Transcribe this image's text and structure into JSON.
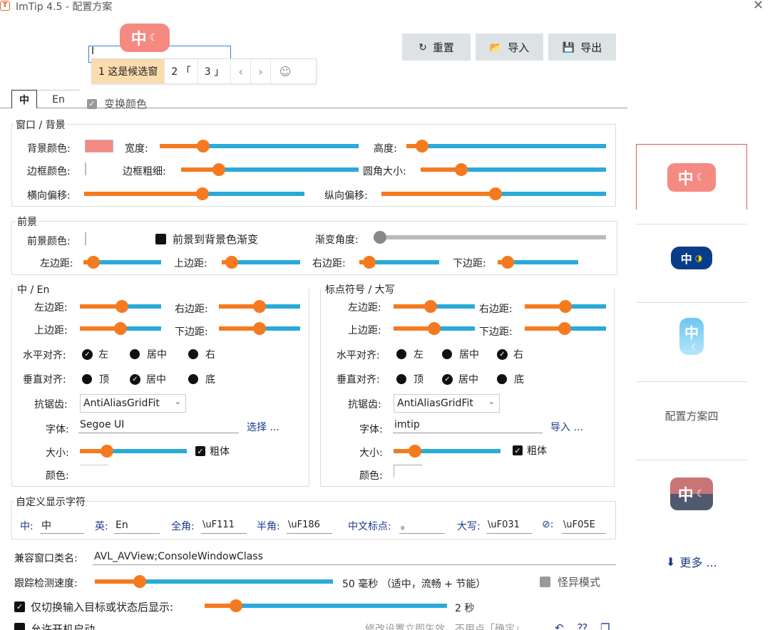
{
  "window": {
    "title": "ImTip 4.5 - 配置方案",
    "close": "✕",
    "icon": "T"
  },
  "preview": {
    "mark": "中",
    "moon": "☾",
    "caret": "I",
    "candidates": [
      {
        "label": "1 这是候选窗"
      },
      {
        "label": "2 「"
      },
      {
        "label": "3 」"
      }
    ],
    "nav_prev": "‹",
    "nav_next": "›",
    "emoji": "☺"
  },
  "toolbar": {
    "reset": {
      "icon": "↻",
      "label": "重置"
    },
    "import": {
      "icon": "📂",
      "label": "导入"
    },
    "export": {
      "icon": "💾",
      "label": "导出"
    }
  },
  "tabs": {
    "zh": "中",
    "en": "En",
    "swap_color": "变换颜色"
  },
  "window_group": {
    "title": "窗口 / 背景",
    "bg_color": "背景颜色:",
    "bg_color_hex": "#f58a83",
    "width": "宽度:",
    "height": "高度:",
    "border_color": "边框颜色:",
    "border_width": "边框粗细:",
    "corner_radius": "圆角大小:",
    "offset_x": "横向偏移:",
    "offset_y": "纵向偏移:",
    "width_value": 0.2,
    "height_value": 0.05,
    "border_width_value": 0.19,
    "corner_radius_value": 0.2,
    "offset_x_value": 0.54,
    "offset_y_value": 0.51
  },
  "fg_group": {
    "title": "前景",
    "fg_color": "前景颜色:",
    "gradient": "前景到背景色渐变",
    "gradient_angle": "渐变角度:",
    "gradient_angle_value": 0,
    "pad_left": "左边距:",
    "pad_top": "上边距:",
    "pad_right": "右边距:",
    "pad_bottom": "下边距:",
    "pad_left_value": 0.05,
    "pad_top_value": 0.05,
    "pad_right_value": 0.05,
    "pad_bottom_value": 0.05
  },
  "zh_group": {
    "title": "中 / En",
    "left": "左边距:",
    "right": "右边距:",
    "top": "上边距:",
    "bottom": "下边距:",
    "halign": "水平对齐:",
    "valign": "垂直对齐:",
    "h_left": "左",
    "h_center": "居中",
    "h_right": "右",
    "v_top": "顶",
    "v_center": "居中",
    "v_bottom": "底",
    "antialias": "抗锯齿:",
    "antialias_value": "AntiAliasGridFit",
    "font": "字体:",
    "font_value": "Segoe UI",
    "font_link": "选择 ...",
    "size": "大小:",
    "bold": "粗体",
    "color": "颜色:",
    "left_value": 0.52,
    "right_value": 0.5,
    "top_value": 0.5,
    "bottom_value": 0.5,
    "size_value": 0.22
  },
  "punct_group": {
    "title": "标点符号 / 大写",
    "left": "左边距:",
    "right": "右边距:",
    "top": "上边距:",
    "bottom": "下边距:",
    "halign": "水平对齐:",
    "valign": "垂直对齐:",
    "h_left": "左",
    "h_center": "居中",
    "h_right": "右",
    "v_top": "顶",
    "v_center": "居中",
    "v_bottom": "底",
    "antialias": "抗锯齿:",
    "antialias_value": "AntiAliasGridFit",
    "font": "字体:",
    "font_value": "imtip",
    "font_link": "导入 ...",
    "size": "大小:",
    "bold": "粗体",
    "color": "颜色:",
    "left_value": 0.45,
    "right_value": 0.5,
    "top_value": 0.5,
    "bottom_value": 0.49,
    "size_value": 0.16
  },
  "custom_chars": {
    "title": "自定义显示字符",
    "zh_label": "中:",
    "zh_value": "中",
    "en_label": "英:",
    "en_value": "En",
    "full_label": "全角:",
    "full_value": "\\uF111",
    "half_label": "半角:",
    "half_value": "\\uF186",
    "punct_label": "中文标点:",
    "punct_value": "。",
    "caps_label": "大写:",
    "caps_value": "\\uF031",
    "none_label": "⊘:",
    "none_value": "\\uF05E"
  },
  "bottom": {
    "compat_label": "兼容窗口类名:",
    "compat_value": "AVL_AVView;ConsoleWindowClass",
    "track_label": "跟踪检测速度:",
    "track_value_text": "50 毫秒 （适中，流畅 + 节能）",
    "weird_mode": "怪异模式",
    "only_switch": "仅切换输入目标或状态后显示:",
    "only_switch_value_text": "2 秒",
    "autostart": "允许开机启动",
    "hint": "修改设置立即生效，不用点「确定」",
    "track_value": 0.17,
    "only_switch_value": 0.11
  },
  "presets": {
    "items": [
      {
        "mark": "中",
        "moon": "☾",
        "bg": "#f58a83"
      },
      {
        "mark": "中",
        "moon": "◑",
        "bg": "#0a3c8c"
      },
      {
        "mark": "中",
        "moon": "☾",
        "bg": "#6cc6f0"
      },
      {
        "label": "配置方案四"
      },
      {
        "mark": "中",
        "moon": "☾",
        "bg": "#c97575"
      }
    ],
    "more": "更多 ...",
    "more_icon": "⬇"
  }
}
